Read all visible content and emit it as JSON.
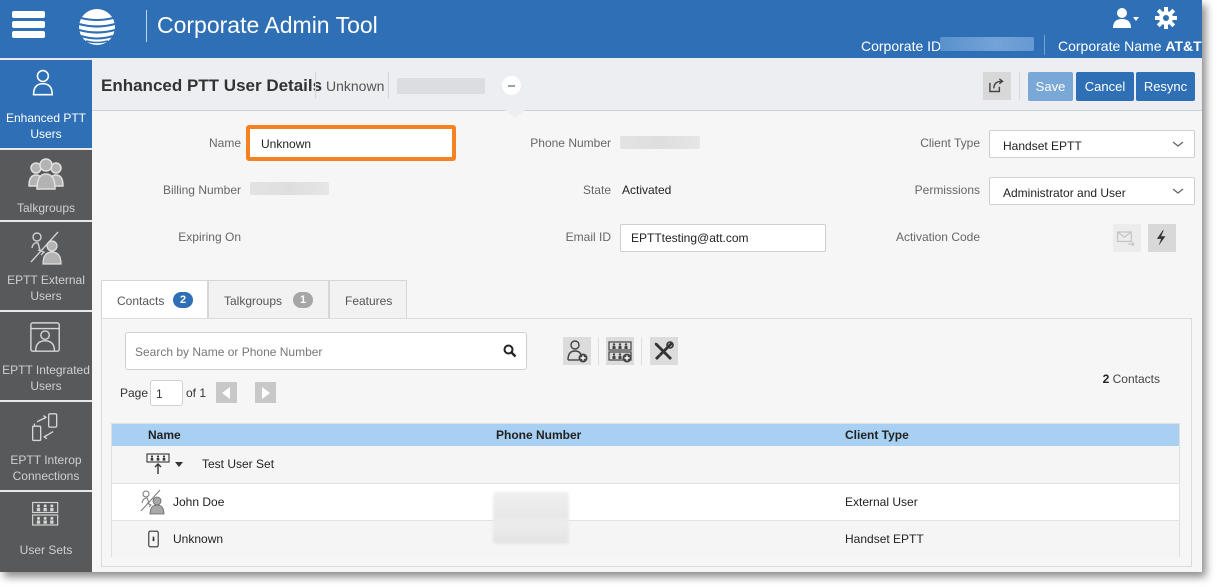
{
  "header": {
    "app_title": "Corporate Admin Tool",
    "corporate_id_label": "Corporate ID",
    "corporate_name_label": "Corporate Name",
    "corporate_name_value": "AT&T",
    "icons": [
      "menu-icon",
      "att-globe-logo",
      "user-menu-icon",
      "gear-icon"
    ]
  },
  "sidebar": {
    "items": [
      {
        "label_line1": "Enhanced PTT",
        "label_line2": "Users",
        "icon": "user-icon",
        "active": true
      },
      {
        "label_line1": "Talkgroups",
        "label_line2": "",
        "icon": "group-icon",
        "active": false
      },
      {
        "label_line1": "EPTT External",
        "label_line2": "Users",
        "icon": "external-user-icon",
        "active": false
      },
      {
        "label_line1": "EPTT Integrated",
        "label_line2": "Users",
        "icon": "integrated-user-icon",
        "active": false
      },
      {
        "label_line1": "EPTT Interop",
        "label_line2": "Connections",
        "icon": "interop-icon",
        "active": false
      },
      {
        "label_line1": "User Sets",
        "label_line2": "",
        "icon": "user-sets-icon",
        "active": false
      }
    ]
  },
  "titlebar": {
    "title": "Enhanced PTT User Details",
    "user_name": "Unknown",
    "buttons": {
      "save": "Save",
      "cancel": "Cancel",
      "resync": "Resync"
    }
  },
  "form": {
    "name_label": "Name",
    "name_value": "Unknown",
    "billing_label": "Billing Number",
    "expiring_label": "Expiring On",
    "phone_label": "Phone Number",
    "state_label": "State",
    "state_value": "Activated",
    "email_label": "Email ID",
    "email_value": "EPTTtesting@att.com",
    "client_type_label": "Client Type",
    "client_type_value": "Handset EPTT",
    "permissions_label": "Permissions",
    "permissions_value": "Administrator and User",
    "activation_label": "Activation Code"
  },
  "tabs": [
    {
      "label": "Contacts",
      "badge": "2",
      "active": true,
      "badge_color": "#2f6fb5"
    },
    {
      "label": "Talkgroups",
      "badge": "1",
      "active": false,
      "badge_color": "#a6a6a6"
    },
    {
      "label": "Features",
      "badge": "",
      "active": false
    }
  ],
  "contacts": {
    "search_placeholder": "Search by Name or Phone Number",
    "page_label": "Page",
    "page_value": "1",
    "page_of": "of 1",
    "count_number": "2",
    "count_label": "Contacts",
    "columns": [
      "Name",
      "Phone Number",
      "Client Type"
    ],
    "rows": [
      {
        "name": "Test User Set",
        "phone": "",
        "client_type": "",
        "icon": "user-set-icon"
      },
      {
        "name": "John Doe",
        "phone": "",
        "client_type": "External User",
        "icon": "external-user-icon"
      },
      {
        "name": "Unknown",
        "phone": "",
        "client_type": "Handset EPTT",
        "icon": "handset-icon"
      }
    ]
  },
  "colors": {
    "brand_blue": "#2f6fb5",
    "highlight_orange": "#f58220",
    "sidebar_gray": "#58595b",
    "table_header": "#a7d0f2"
  }
}
